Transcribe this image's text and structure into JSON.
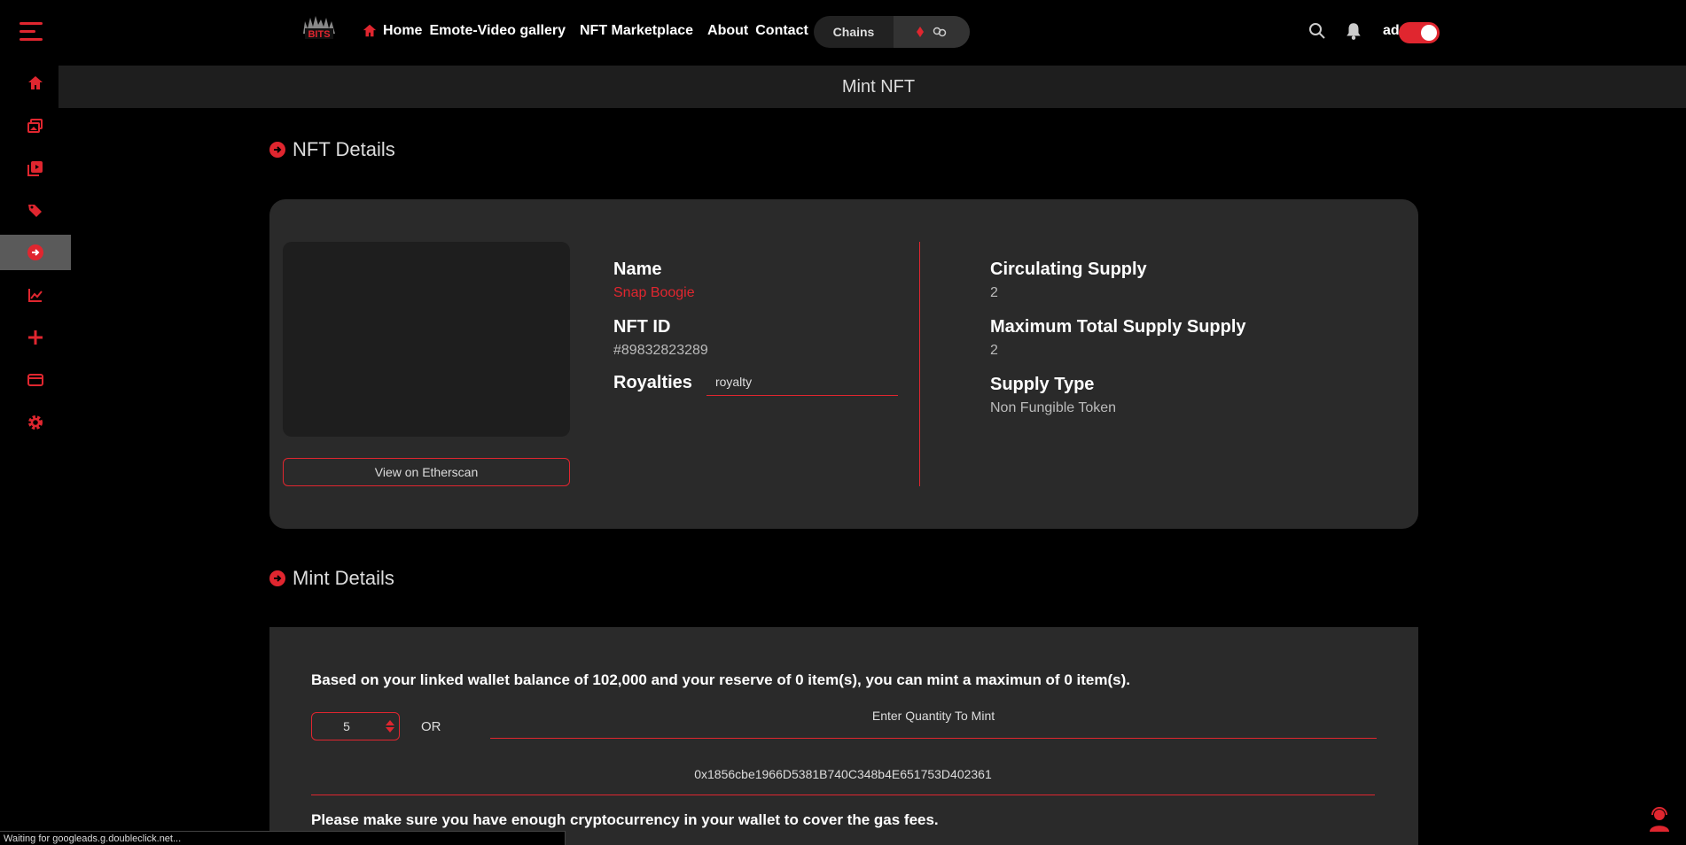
{
  "nav": {
    "home": "Home",
    "emote": "Emote-Video gallery",
    "marketplace": "NFT Marketplace",
    "about": "About",
    "contact": "Contact",
    "chains": "Chains",
    "user": "admin"
  },
  "page": {
    "title": "Mint NFT"
  },
  "nft_details": {
    "heading": "NFT Details",
    "name_label": "Name",
    "name_value": "Snap Boogie",
    "id_label": "NFT ID",
    "id_value": "#89832823289",
    "royalties_label": "Royalties",
    "royalty_placeholder": "royalty",
    "etherscan_button": "View on Etherscan",
    "circ_label": "Circulating Supply",
    "circ_value": "2",
    "max_label": "Maximum Total Supply Supply",
    "max_value": "2",
    "type_label": "Supply Type",
    "type_value": "Non Fungible Token"
  },
  "mint_details": {
    "heading": "Mint Details",
    "balance_text": "Based on your linked wallet balance of 102,000 and your reserve of 0 item(s), you can mint a maximun of 0 item(s).",
    "stepper_value": "5",
    "or_label": "OR",
    "quantity_placeholder": "Enter Quantity To Mint",
    "address": "0x1856cbe1966D5381B740C348b4E651753D402361",
    "warning": "Please make sure you have enough cryptocurrency in your wallet to cover the gas fees."
  },
  "status": "Waiting for googleads.g.doubleclick.net...",
  "colors": {
    "accent": "#e0262f",
    "card": "#2a2a2a",
    "background": "#000000"
  }
}
